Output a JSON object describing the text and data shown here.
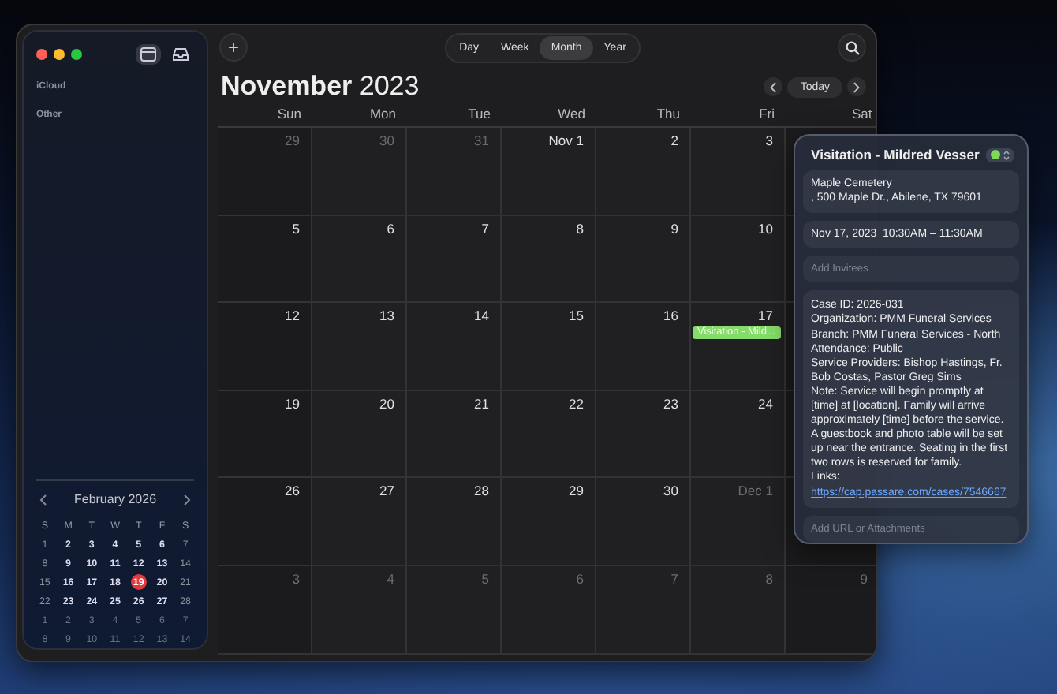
{
  "sidebar": {
    "sections": [
      "iCloud",
      "Other"
    ],
    "mini_calendar": {
      "title": "February 2026",
      "weekdays": [
        "S",
        "M",
        "T",
        "W",
        "T",
        "F",
        "S"
      ],
      "weeks": [
        [
          {
            "label": "1",
            "other_month": false,
            "selected": false
          },
          {
            "label": "2",
            "other_month": false,
            "selected": false
          },
          {
            "label": "3",
            "other_month": false,
            "selected": false
          },
          {
            "label": "4",
            "other_month": false,
            "selected": false
          },
          {
            "label": "5",
            "other_month": false,
            "selected": false
          },
          {
            "label": "6",
            "other_month": false,
            "selected": false
          },
          {
            "label": "7",
            "other_month": false,
            "selected": false
          }
        ],
        [
          {
            "label": "8",
            "other_month": false,
            "selected": false
          },
          {
            "label": "9",
            "other_month": false,
            "selected": false
          },
          {
            "label": "10",
            "other_month": false,
            "selected": false
          },
          {
            "label": "11",
            "other_month": false,
            "selected": false
          },
          {
            "label": "12",
            "other_month": false,
            "selected": false
          },
          {
            "label": "13",
            "other_month": false,
            "selected": false
          },
          {
            "label": "14",
            "other_month": false,
            "selected": false
          }
        ],
        [
          {
            "label": "15",
            "other_month": false,
            "selected": false
          },
          {
            "label": "16",
            "other_month": false,
            "selected": false
          },
          {
            "label": "17",
            "other_month": false,
            "selected": false
          },
          {
            "label": "18",
            "other_month": false,
            "selected": false
          },
          {
            "label": "19",
            "other_month": false,
            "selected": true
          },
          {
            "label": "20",
            "other_month": false,
            "selected": false
          },
          {
            "label": "21",
            "other_month": false,
            "selected": false
          }
        ],
        [
          {
            "label": "22",
            "other_month": false,
            "selected": false
          },
          {
            "label": "23",
            "other_month": false,
            "selected": false
          },
          {
            "label": "24",
            "other_month": false,
            "selected": false
          },
          {
            "label": "25",
            "other_month": false,
            "selected": false
          },
          {
            "label": "26",
            "other_month": false,
            "selected": false
          },
          {
            "label": "27",
            "other_month": false,
            "selected": false
          },
          {
            "label": "28",
            "other_month": false,
            "selected": false
          }
        ],
        [
          {
            "label": "1",
            "other_month": true,
            "selected": false
          },
          {
            "label": "2",
            "other_month": true,
            "selected": false
          },
          {
            "label": "3",
            "other_month": true,
            "selected": false
          },
          {
            "label": "4",
            "other_month": true,
            "selected": false
          },
          {
            "label": "5",
            "other_month": true,
            "selected": false
          },
          {
            "label": "6",
            "other_month": true,
            "selected": false
          },
          {
            "label": "7",
            "other_month": true,
            "selected": false
          }
        ],
        [
          {
            "label": "8",
            "other_month": true,
            "selected": false
          },
          {
            "label": "9",
            "other_month": true,
            "selected": false
          },
          {
            "label": "10",
            "other_month": true,
            "selected": false
          },
          {
            "label": "11",
            "other_month": true,
            "selected": false
          },
          {
            "label": "12",
            "other_month": true,
            "selected": false
          },
          {
            "label": "13",
            "other_month": true,
            "selected": false
          },
          {
            "label": "14",
            "other_month": true,
            "selected": false
          }
        ]
      ]
    }
  },
  "toolbar": {
    "add": "+",
    "views": [
      {
        "label": "Day",
        "selected": false
      },
      {
        "label": "Week",
        "selected": false
      },
      {
        "label": "Month",
        "selected": true
      },
      {
        "label": "Year",
        "selected": false
      }
    ]
  },
  "month": {
    "title": "**November** 2023",
    "today": "Today",
    "weekdays": [
      "Sun",
      "Mon",
      "Tue",
      "Wed",
      "Thu",
      "Fri",
      "Sat"
    ],
    "weeks": [
      [
        {
          "label": "29",
          "other_month": true
        },
        {
          "label": "30",
          "other_month": true
        },
        {
          "label": "31",
          "other_month": true
        },
        {
          "label": "Nov 1",
          "other_month": false
        },
        {
          "label": "2",
          "other_month": false
        },
        {
          "label": "3",
          "other_month": false
        }
      ],
      [
        {
          "label": "5",
          "other_month": false
        },
        {
          "label": "6",
          "other_month": false
        },
        {
          "label": "7",
          "other_month": false
        },
        {
          "label": "8",
          "other_month": false
        },
        {
          "label": "9",
          "other_month": false
        },
        {
          "label": "10",
          "other_month": false
        }
      ],
      [
        {
          "label": "12",
          "other_month": false
        },
        {
          "label": "13",
          "other_month": false
        },
        {
          "label": "14",
          "other_month": false
        },
        {
          "label": "15",
          "other_month": false
        },
        {
          "label": "16",
          "other_month": false
        },
        {
          "label": "17",
          "other_month": false,
          "events": [
            {
              "title": "Visitation - Mild...",
              "color": "#86dc6a"
            }
          ]
        }
      ],
      [
        {
          "label": "19",
          "other_month": false
        },
        {
          "label": "20",
          "other_month": false
        },
        {
          "label": "21",
          "other_month": false
        },
        {
          "label": "22",
          "other_month": false
        },
        {
          "label": "23",
          "other_month": false
        },
        {
          "label": "24",
          "other_month": false
        }
      ],
      [
        {
          "label": "26",
          "other_month": false
        },
        {
          "label": "27",
          "other_month": false
        },
        {
          "label": "28",
          "other_month": false
        },
        {
          "label": "29",
          "other_month": false
        },
        {
          "label": "30",
          "other_month": false
        },
        {
          "label": "Dec 1",
          "other_month": true
        }
      ],
      [
        {
          "label": "3",
          "other_month": true
        },
        {
          "label": "4",
          "other_month": true
        },
        {
          "label": "5",
          "other_month": true
        },
        {
          "label": "6",
          "other_month": true
        },
        {
          "label": "7",
          "other_month": true
        },
        {
          "label": "8",
          "other_month": true
        },
        {
          "label": "9",
          "other_month": true
        }
      ]
    ]
  },
  "event": {
    "title": "Visitation - Mildred Vesser",
    "color": "#7ed957",
    "location": [
      "Maple Cemetery",
      ", 500 Maple Dr., Abilene, TX 79601"
    ],
    "time": "Nov 17, 2023  10:30AM – 11:30AM",
    "invitees": {
      "placeholder": "Add Invitees"
    },
    "notes": [
      "Case ID: 2026-031",
      "Organization: PMM Funeral Services",
      "Branch: PMM Funeral Services - North",
      "Attendance: Public",
      "Service Providers: Bishop Hastings, Fr. Bob Costas, Pastor Greg Sims",
      "Note: Service will begin promptly at [time] at [location]. Family will arrive approximately [time] before the service. A guestbook and photo table will be set up near the entrance. Seating in the first two rows is reserved for family."
    ],
    "links_label": "Links:",
    "link": "https://cap.passare.com/cases/7546667",
    "attachments": {
      "placeholder": "Add URL or Attachments"
    }
  }
}
